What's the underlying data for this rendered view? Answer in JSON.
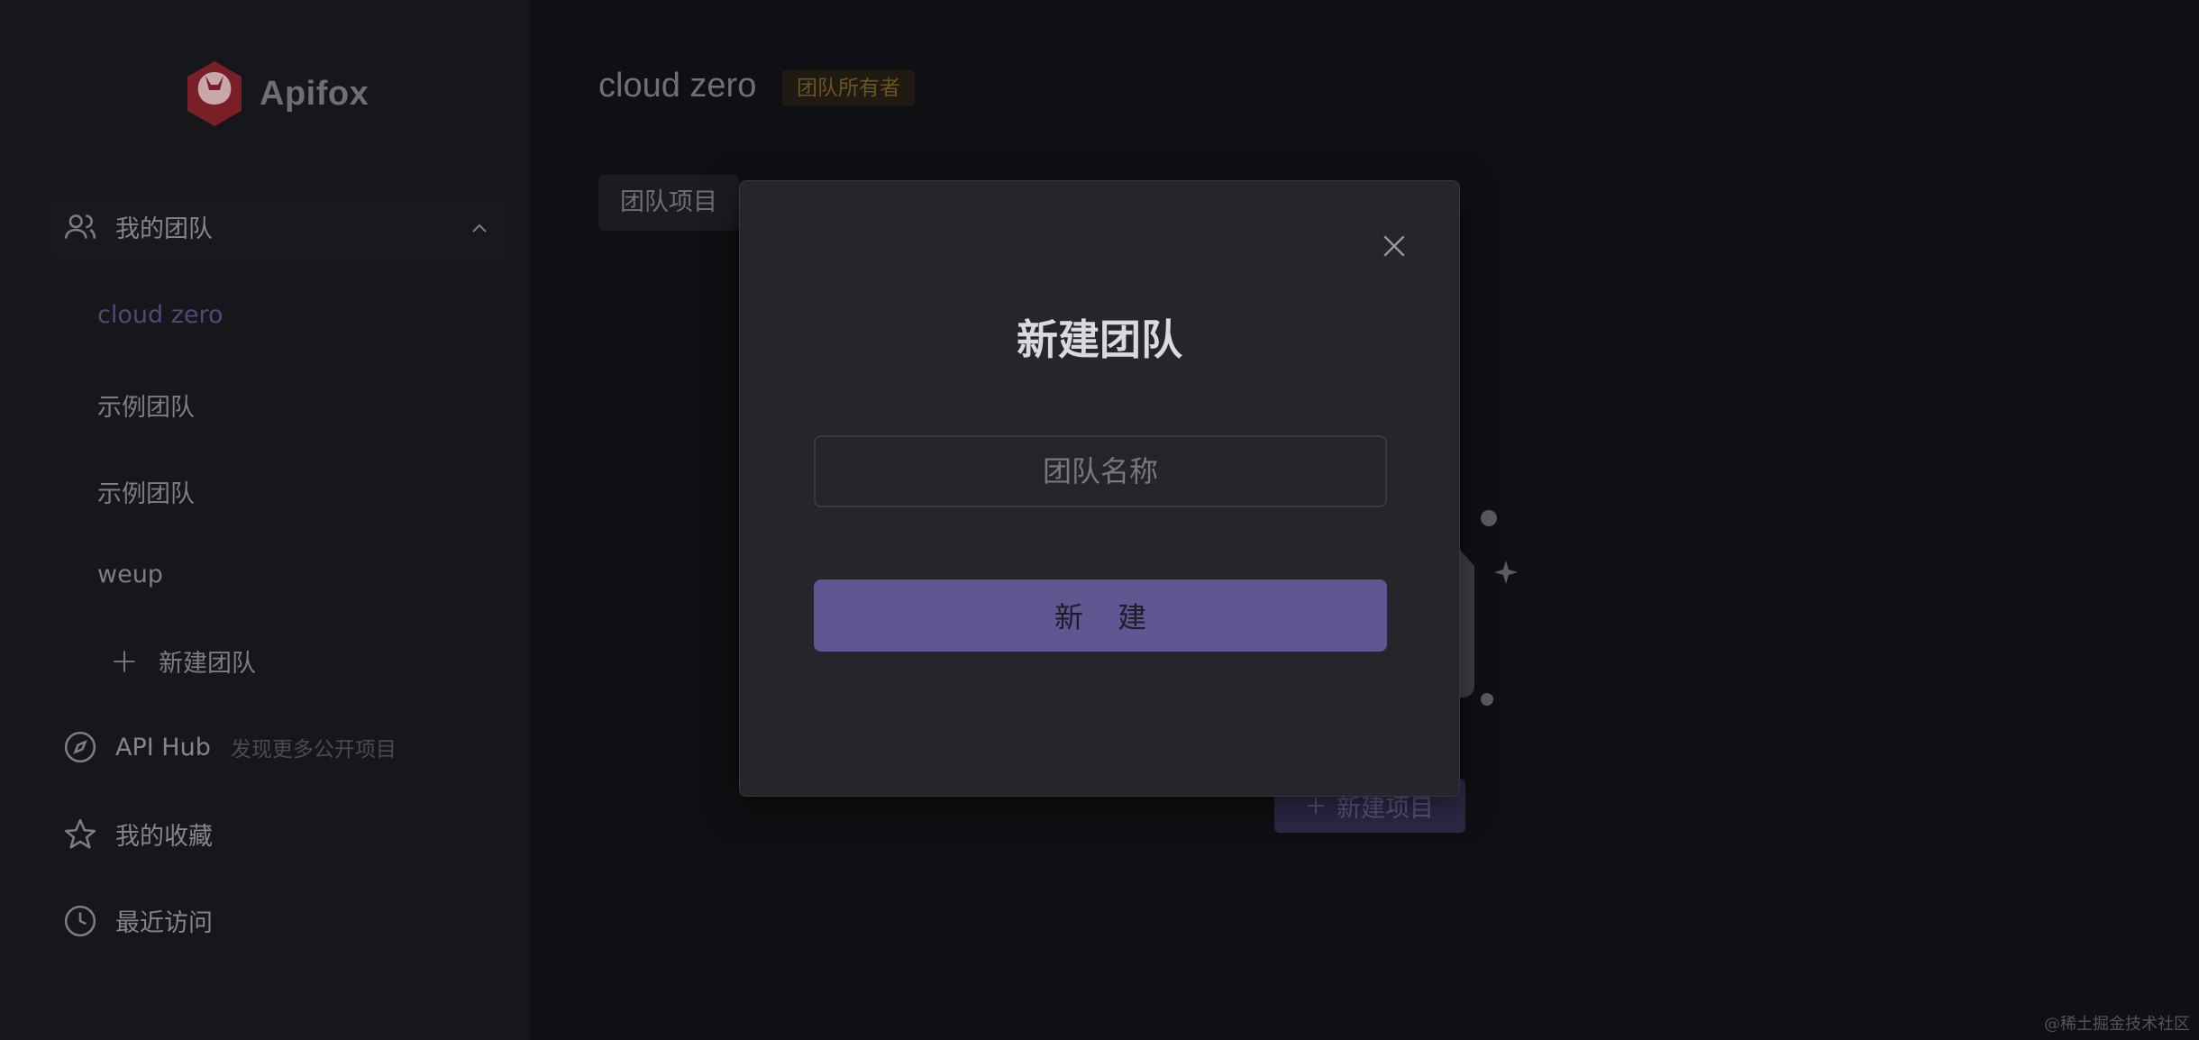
{
  "brand": {
    "name": "Apifox",
    "color": "#c02d3c"
  },
  "sidebar": {
    "my_teams_label": "我的团队",
    "teams": [
      {
        "label": "cloud zero",
        "active": true
      },
      {
        "label": "示例团队",
        "active": false
      },
      {
        "label": "示例团队",
        "active": false
      },
      {
        "label": "weup",
        "active": false
      }
    ],
    "new_team_label": "新建团队",
    "api_hub_label": "API Hub",
    "api_hub_sub": "发现更多公开项目",
    "favorites_label": "我的收藏",
    "recent_label": "最近访问"
  },
  "main": {
    "title": "cloud zero",
    "owner_badge": "团队所有者",
    "tab_label": "团队项目",
    "new_project_label": "新建项目"
  },
  "modal": {
    "title": "新建团队",
    "input_placeholder": "团队名称",
    "input_value": "",
    "submit_label": "新 建",
    "accent": "#5e5791"
  },
  "watermark": "@稀土掘金技术社区"
}
